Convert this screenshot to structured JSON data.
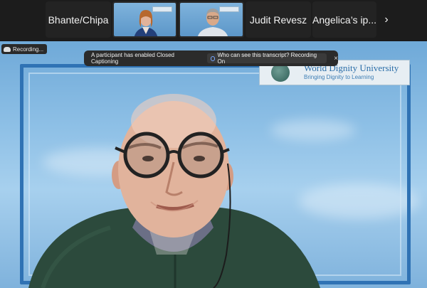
{
  "participants": [
    {
      "type": "name",
      "label": "Bhante/Chipa"
    },
    {
      "type": "video",
      "label": ""
    },
    {
      "type": "video",
      "label": ""
    },
    {
      "type": "name",
      "label": "Judit Revesz"
    },
    {
      "type": "name",
      "label": "Angelica’s ip..."
    }
  ],
  "strip": {
    "next_icon": "›"
  },
  "recording": {
    "label": "Recording..."
  },
  "caption_banner": {
    "message": "A participant has enabled Closed Captioning",
    "link": "Who can see this transcript? Recording On",
    "close_icon": "×"
  },
  "background_logo": {
    "title": "World Dignity University",
    "subtitle": "Bringing Dignity to Learning"
  },
  "colors": {
    "banner_bg": "#2b2b2b",
    "frame_blue": "#2f72b4",
    "sweater": "#2c4a3c"
  }
}
